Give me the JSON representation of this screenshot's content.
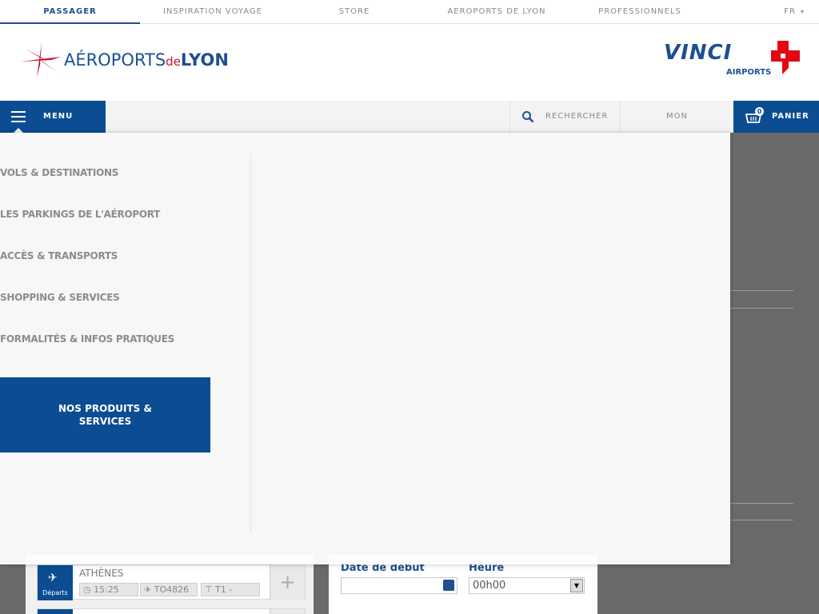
{
  "top_nav": {
    "tabs": [
      {
        "label": "PASSAGER",
        "active": true
      },
      {
        "label": "INSPIRATION VOYAGE",
        "active": false
      },
      {
        "label": "STORE",
        "active": false
      },
      {
        "label": "AEROPORTS DE LYON",
        "active": false
      },
      {
        "label": "PROFESSIONNELS",
        "active": false
      }
    ],
    "language": "FR"
  },
  "header": {
    "logo_prefix": "AÉROPORTS",
    "logo_de": "de",
    "logo_city": "LYON",
    "partner_logo": "VINCI",
    "partner_sub": "AIRPORTS"
  },
  "main_bar": {
    "menu_label": "MENU",
    "search_label": "RECHERCHER",
    "account_label": "MON",
    "cart_label": "PANIER",
    "cart_count": "0"
  },
  "menu": {
    "items": [
      "VOLS & DESTINATIONS",
      "LES PARKINGS DE L'AÉROPORT",
      "ACCÈS & TRANSPORTS",
      "SHOPPING & SERVICES",
      "FORMALITÉS & INFOS PRATIQUES"
    ],
    "cta": "NOS PRODUITS & SERVICES"
  },
  "flights": {
    "rows": [
      {
        "type": "Départs",
        "city": "ATHÈNES",
        "time": "15:25",
        "flight": "TO4826",
        "terminal": "T1 -"
      }
    ]
  },
  "booking": {
    "start_date_label": "Date de début",
    "start_date_value": "",
    "hour_label": "Heure",
    "hour_value": "00h00"
  },
  "colors": {
    "brand_blue": "#0b4c93",
    "brand_red": "#c8102e",
    "overlay_bg": "#fdfdfd"
  },
  "icons": [
    "menu-icon",
    "search-icon",
    "cart-icon",
    "plane-icon",
    "clock-icon",
    "calendar-icon",
    "plus-icon"
  ]
}
